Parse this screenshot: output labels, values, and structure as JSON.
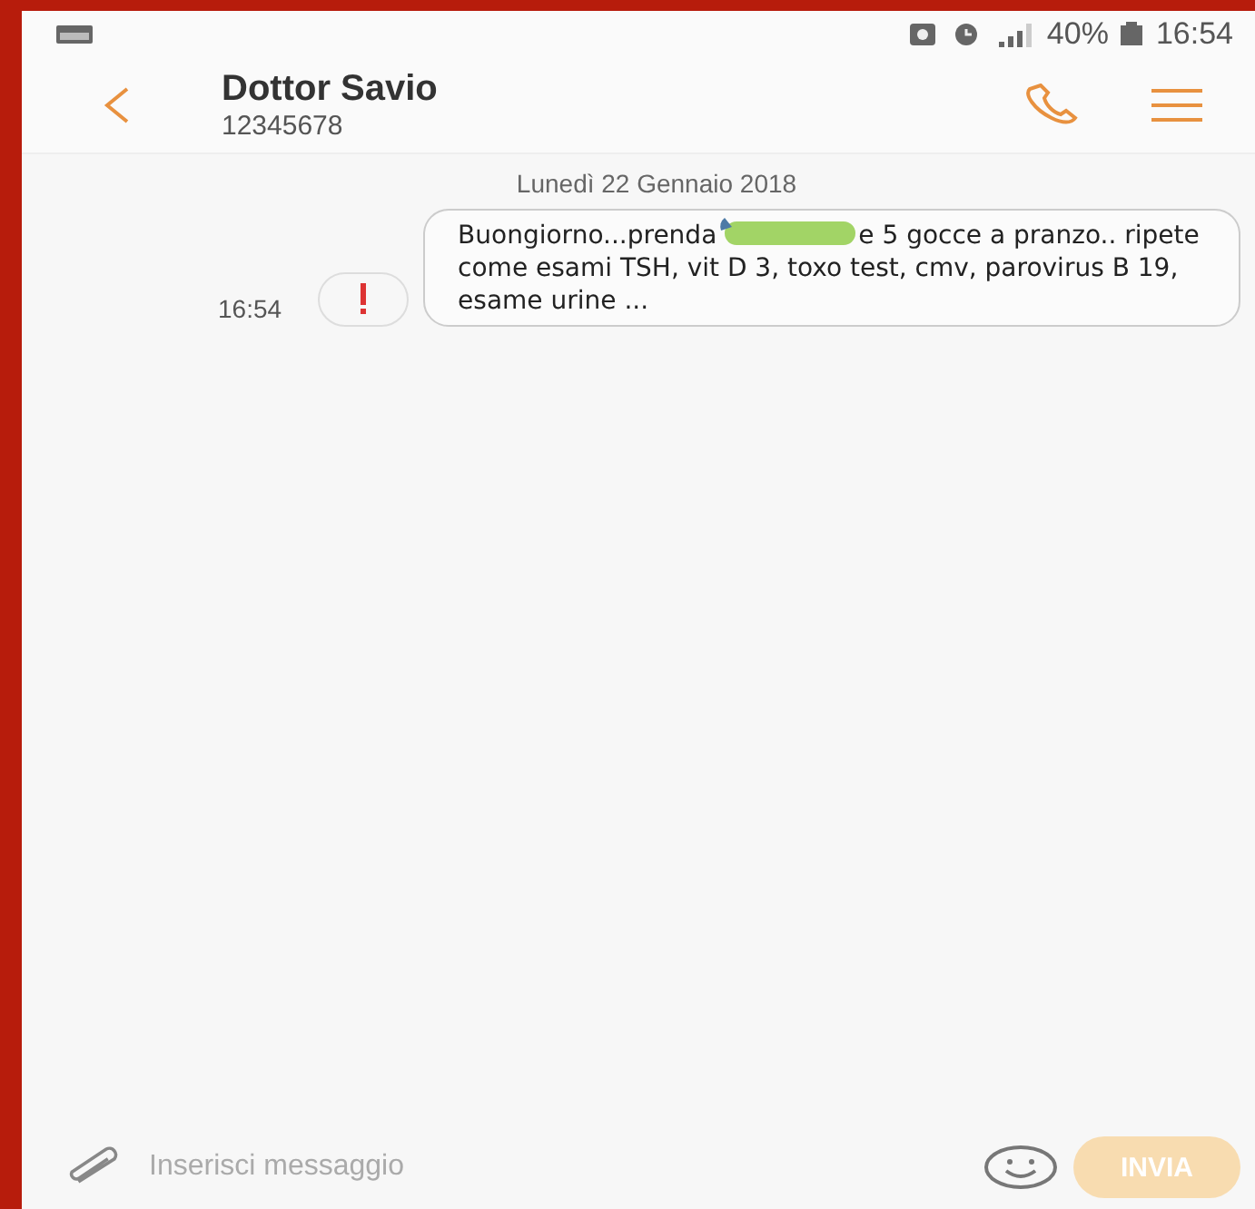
{
  "status_bar": {
    "battery": "40%",
    "time": "16:54"
  },
  "header": {
    "title": "Dottor Savio",
    "subtitle": "12345678"
  },
  "conversation": {
    "date": "Lunedì 22 Gennaio 2018",
    "messages": [
      {
        "time": "16:54",
        "failed": true,
        "text_before": "Buongiorno...prenda",
        "redacted": true,
        "text_after": "e 5 gocce a pranzo.. ripete come esami TSH, vit D 3, toxo test, cmv, parovirus B 19, esame urine ..."
      }
    ]
  },
  "composer": {
    "placeholder": "Inserisci messaggio",
    "send_label": "INVIA",
    "send_disabled": true
  }
}
